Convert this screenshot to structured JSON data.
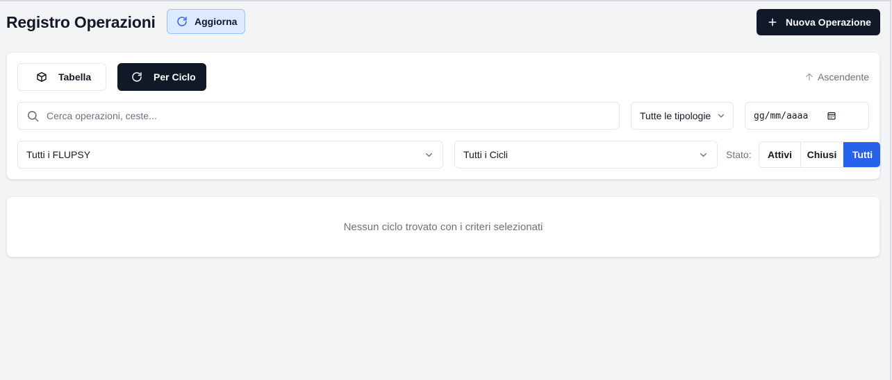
{
  "header": {
    "title": "Registro Operazioni",
    "refresh_label": "Aggiorna",
    "new_operation_label": "Nuova Operazione"
  },
  "view_toggle": {
    "table_label": "Tabella",
    "cycle_label": "Per Ciclo",
    "active": "Per Ciclo"
  },
  "sort": {
    "label": "Ascendente"
  },
  "filters": {
    "search_placeholder": "Cerca operazioni, ceste...",
    "search_value": "",
    "type_select": "Tutte le tipologie",
    "date_placeholder": "gg/mm/aaaa",
    "flupsy_select": "Tutti i FLUPSY",
    "cycle_select": "Tutti i Cicli",
    "status_label": "Stato:",
    "status_options": [
      "Attivi",
      "Chiusi",
      "Tutti"
    ],
    "status_selected": "Tutti"
  },
  "empty_state": {
    "message": "Nessun ciclo trovato con i criteri selezionati"
  },
  "colors": {
    "primary_dark": "#111827",
    "accent_blue": "#2563eb",
    "refresh_bg": "#dbeafe",
    "page_bg": "#f3f4f6"
  },
  "icons": {
    "refresh": "refresh-icon",
    "plus": "plus-icon",
    "table": "cube-icon",
    "cycle": "refresh-icon",
    "sort": "arrow-up-icon",
    "search": "search-icon",
    "chevron": "chevron-down-icon",
    "calendar": "calendar-icon"
  }
}
